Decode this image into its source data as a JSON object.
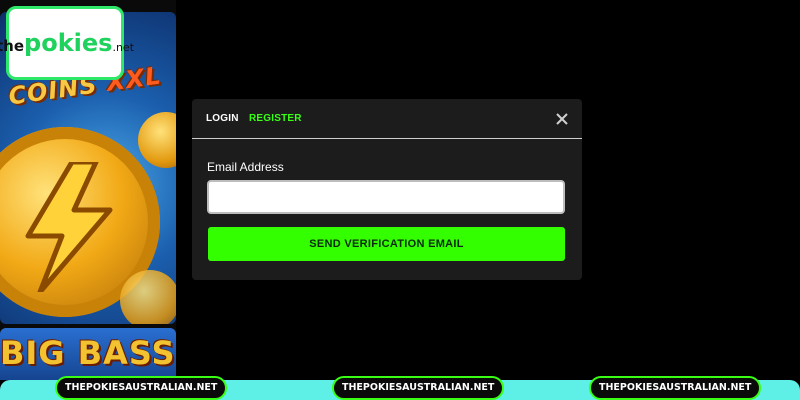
{
  "brand": {
    "logo_prefix": "the",
    "logo_main": "pokies",
    "logo_suffix": ".net"
  },
  "games": [
    {
      "title_a": "COINS",
      "title_b": "XXL"
    },
    {
      "title": "BIG BASS"
    }
  ],
  "modal": {
    "tabs": [
      {
        "label": "LOGIN",
        "active": true
      },
      {
        "label": "REGISTER",
        "active": false
      }
    ],
    "email_label": "Email Address",
    "email_value": "",
    "email_placeholder": "",
    "submit_label": "SEND VERIFICATION EMAIL",
    "accent_color": "#33ff00"
  },
  "watermarks": [
    "THEPOKIESAUSTRALIAN.NET",
    "THEPOKIESAUSTRALIAN.NET",
    "THEPOKIESAUSTRALIAN.NET"
  ],
  "icons": {
    "close": "close-icon"
  }
}
